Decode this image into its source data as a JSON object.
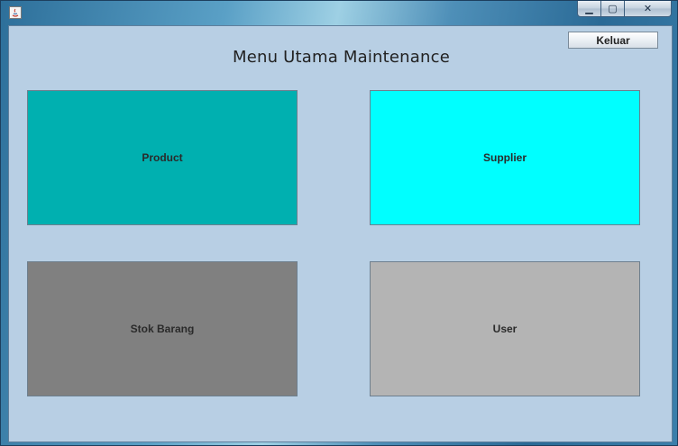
{
  "window": {
    "controls": {
      "minimize_glyph": "▁",
      "maximize_glyph": "▢",
      "close_glyph": "✕"
    }
  },
  "main": {
    "title": "Menu Utama Maintenance",
    "exit_label": "Keluar",
    "tiles": [
      {
        "label": "Product",
        "color": "#00b0b0"
      },
      {
        "label": "Supplier",
        "color": "#00ffff"
      },
      {
        "label": "Stok Barang",
        "color": "#808080"
      },
      {
        "label": "User",
        "color": "#b4b4b4"
      }
    ]
  }
}
